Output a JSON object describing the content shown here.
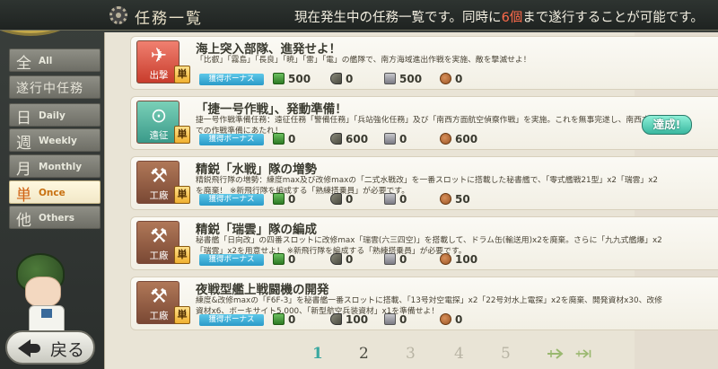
{
  "header": {
    "title": "任務一覧",
    "info_prefix": "現在発生中の任務一覧です。同時に",
    "info_count": "6個",
    "info_suffix": "まで遂行することが可能です。"
  },
  "sidebar": {
    "items": [
      {
        "kanji": "全",
        "label": "All"
      },
      {
        "kanji": "遂行中任務",
        "label": ""
      },
      {
        "kanji": "日",
        "label": "Daily"
      },
      {
        "kanji": "週",
        "label": "Weekly"
      },
      {
        "kanji": "月",
        "label": "Monthly"
      },
      {
        "kanji": "単",
        "label": "Once"
      },
      {
        "kanji": "他",
        "label": "Others"
      }
    ],
    "active": "Once"
  },
  "back_button": {
    "label": "戻る"
  },
  "quests": [
    {
      "category": "出撃",
      "single": "単",
      "title": "海上突入部隊、進発せよ！",
      "desc": "「比叡」「霧島」「長良」「暁」「雷」「電」の艦隊で、南方海域進出作戦を実施、敵を撃滅せよ！",
      "bonus": "獲得ボーナス",
      "fuel": "500",
      "ammo": "0",
      "steel": "500",
      "baux": "0",
      "status": ""
    },
    {
      "category": "遠征",
      "single": "単",
      "title": "「捷一号作戦」、発動準備！",
      "desc": "捷一号作戦準備任務：遠征任務「警備任務」「兵站強化任務」及び「南西方面航空偵察作戦」を実施。これを無事完遂し、南西方面での作戦準備にあたれ！",
      "bonus": "獲得ボーナス",
      "fuel": "0",
      "ammo": "600",
      "steel": "0",
      "baux": "600",
      "status": "達成!"
    },
    {
      "category": "工廠",
      "single": "単",
      "title": "精鋭「水戦」隊の増勢",
      "desc": "精鋭飛行隊の増勢：練度max及び改修maxの「二式水戦改」を一番スロットに搭載した秘書艦で、「零式艦戦21型」x2「瑞雲」x2を廃棄！ ※新飛行隊を編成する「熟練搭乗員」が必要です。",
      "bonus": "獲得ボーナス",
      "fuel": "0",
      "ammo": "0",
      "steel": "0",
      "baux": "50",
      "status": ""
    },
    {
      "category": "工廠",
      "single": "単",
      "title": "精鋭「瑞雲」隊の編成",
      "desc": "秘書艦「日向改」の四番スロットに改修max「瑞雲(六三四空)」を搭載して、ドラム缶(輸送用)x2を廃棄。さらに「九九式艦爆」x2「瑞雲」x2を用意せよ！ ※新飛行隊を編成する「熟練搭乗員」が必要です。",
      "bonus": "獲得ボーナス",
      "fuel": "0",
      "ammo": "0",
      "steel": "0",
      "baux": "100",
      "status": ""
    },
    {
      "category": "工廠",
      "single": "単",
      "title": "夜戦型艦上戦闘機の開発",
      "desc": "練度&改修maxの「F6F-3」を秘書艦一番スロットに搭載、「13号対空電探」x2「22号対水上電探」x2を廃棄、開発資材x30、改修資材x6、ボーキサイト5,000、「新型航空兵装資材」x1を準備せよ！",
      "bonus": "獲得ボーナス",
      "fuel": "0",
      "ammo": "100",
      "steel": "0",
      "baux": "0",
      "status": ""
    }
  ],
  "pagination": {
    "pages": [
      "1",
      "2",
      "3",
      "4",
      "5"
    ],
    "current": "1"
  },
  "colors": {
    "accent_teal": "#3aa8a0",
    "highlight_red": "#ff6a4a",
    "active_tab": "#d06010"
  }
}
